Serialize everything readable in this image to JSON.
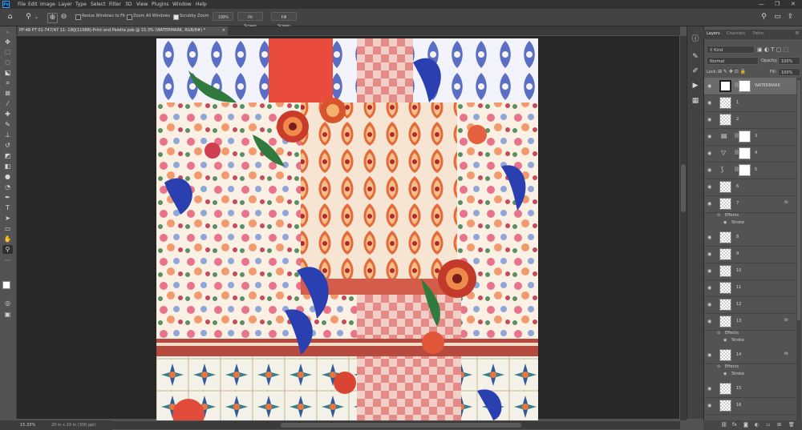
{
  "menubar": {
    "items": [
      "File",
      "Edit",
      "Image",
      "Layer",
      "Type",
      "Select",
      "Filter",
      "3D",
      "View",
      "Plugins",
      "Window",
      "Help"
    ],
    "logo": "Ps"
  },
  "options": {
    "resize_windows": "Resize Windows to Fit",
    "zoom_all_windows": "Zoom All Windows",
    "scrubby_zoom": "Scrubby Zoom",
    "zoom_pct": "100%",
    "fit_screen": "Fit Screen",
    "fill_screen": "Fill Screen"
  },
  "document": {
    "tab_title": "PP-48 PT 01-747/47 11- 1WJ(11088)-Print and Palette.psb @ 15.3% (WATERMARK, RGB/8#) *",
    "close": "×"
  },
  "status": {
    "zoom": "15.33%",
    "doc_size": "20 in x 20 in (300 ppi)"
  },
  "layers_panel": {
    "tabs": [
      "Layers",
      "Channels",
      "Paths"
    ],
    "kind_filter": "Kind",
    "blend_mode": "Normal",
    "opacity_label": "Opacity:",
    "opacity_value": "100%",
    "lock_label": "Lock:",
    "fill_label": "Fill:",
    "fill_value": "100%",
    "layers": [
      {
        "name": "WATERMARK",
        "selected": true,
        "mask": true,
        "thumb": "document-icon"
      },
      {
        "name": "1"
      },
      {
        "name": "2"
      },
      {
        "name": "3",
        "mask": true,
        "thumb": "levels-icon"
      },
      {
        "name": "4",
        "mask": true,
        "thumb": "triangle-icon"
      },
      {
        "name": "5",
        "mask": true,
        "thumb": "curves-icon"
      },
      {
        "name": "6"
      },
      {
        "name": "7",
        "fx": "fx",
        "effects": "Effects",
        "stroke": "Stroke"
      },
      {
        "name": "8"
      },
      {
        "name": "9"
      },
      {
        "name": "10"
      },
      {
        "name": "11"
      },
      {
        "name": "12"
      },
      {
        "name": "13",
        "fx": "fx",
        "effects": "Effects",
        "stroke": "Stroke"
      },
      {
        "name": "14",
        "fx": "fx",
        "effects": "Effects",
        "stroke": "Stroke"
      },
      {
        "name": "15"
      },
      {
        "name": "16"
      }
    ]
  },
  "colors": {
    "ps_blue": "#31a8ff",
    "foreground": "#ffffff",
    "background": "#1d3a6b"
  }
}
